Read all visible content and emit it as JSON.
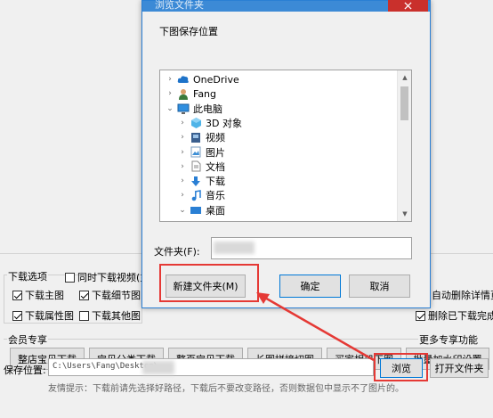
{
  "dialog": {
    "title": "浏览文件夹",
    "prompt": "下图保存位置",
    "tree": [
      {
        "label": "OneDrive",
        "icon": "cloud-icon",
        "expander": "›",
        "indent": 0
      },
      {
        "label": "Fang",
        "icon": "user-icon",
        "expander": "›",
        "indent": 0
      },
      {
        "label": "此电脑",
        "icon": "computer-icon",
        "expander": "⌄",
        "indent": 0
      },
      {
        "label": "3D 对象",
        "icon": "cube-icon",
        "expander": "›",
        "indent": 1
      },
      {
        "label": "视频",
        "icon": "video-icon",
        "expander": "›",
        "indent": 1
      },
      {
        "label": "图片",
        "icon": "picture-icon",
        "expander": "›",
        "indent": 1
      },
      {
        "label": "文档",
        "icon": "document-icon",
        "expander": "›",
        "indent": 1
      },
      {
        "label": "下载",
        "icon": "download-icon",
        "expander": "›",
        "indent": 1
      },
      {
        "label": "音乐",
        "icon": "music-icon",
        "expander": "›",
        "indent": 1
      },
      {
        "label": "桌面",
        "icon": "desktop-icon",
        "expander": "⌄",
        "indent": 1
      },
      {
        "label": "",
        "icon": "folder-icon",
        "expander": "",
        "indent": 2
      }
    ],
    "folder_label": "文件夹(F):",
    "folder_value": "",
    "new_folder_label": "新建文件夹(M)",
    "ok_label": "确定",
    "cancel_label": "取消"
  },
  "app": {
    "download_options_label": "下载选项",
    "checkboxes": [
      {
        "label": "同时下载视频(主",
        "checked": false
      },
      {
        "label": "下载主图",
        "checked": true
      },
      {
        "label": "下载细节图",
        "checked": true
      },
      {
        "label": "下载属性图",
        "checked": true
      },
      {
        "label": "下载其他图",
        "checked": false
      },
      {
        "label": "自动删除详情页",
        "checked": true
      },
      {
        "label": "删除已下载完成的",
        "checked": true
      }
    ],
    "member_label": "会员专享",
    "more_label": "更多专享功能>>>",
    "feature_buttons": [
      "整店宝贝下载",
      "宝贝分类下载",
      "整页宝贝下载",
      "长图拼接切图",
      "买家相册下图",
      "批量加水印设置"
    ],
    "save_location_label": "保存位置:",
    "save_path": "C:\\Users\\Fang\\Desktop\\",
    "browse_label": "浏览",
    "open_folder_label": "打开文件夹",
    "tip": "友情提示：下载前请先选择好路径，下载后不要改变路径，否则数据包中显示不了图片的。"
  },
  "colors": {
    "highlight": "#e53935",
    "titlebar": "#3c8ad6",
    "close": "#c9302c"
  }
}
